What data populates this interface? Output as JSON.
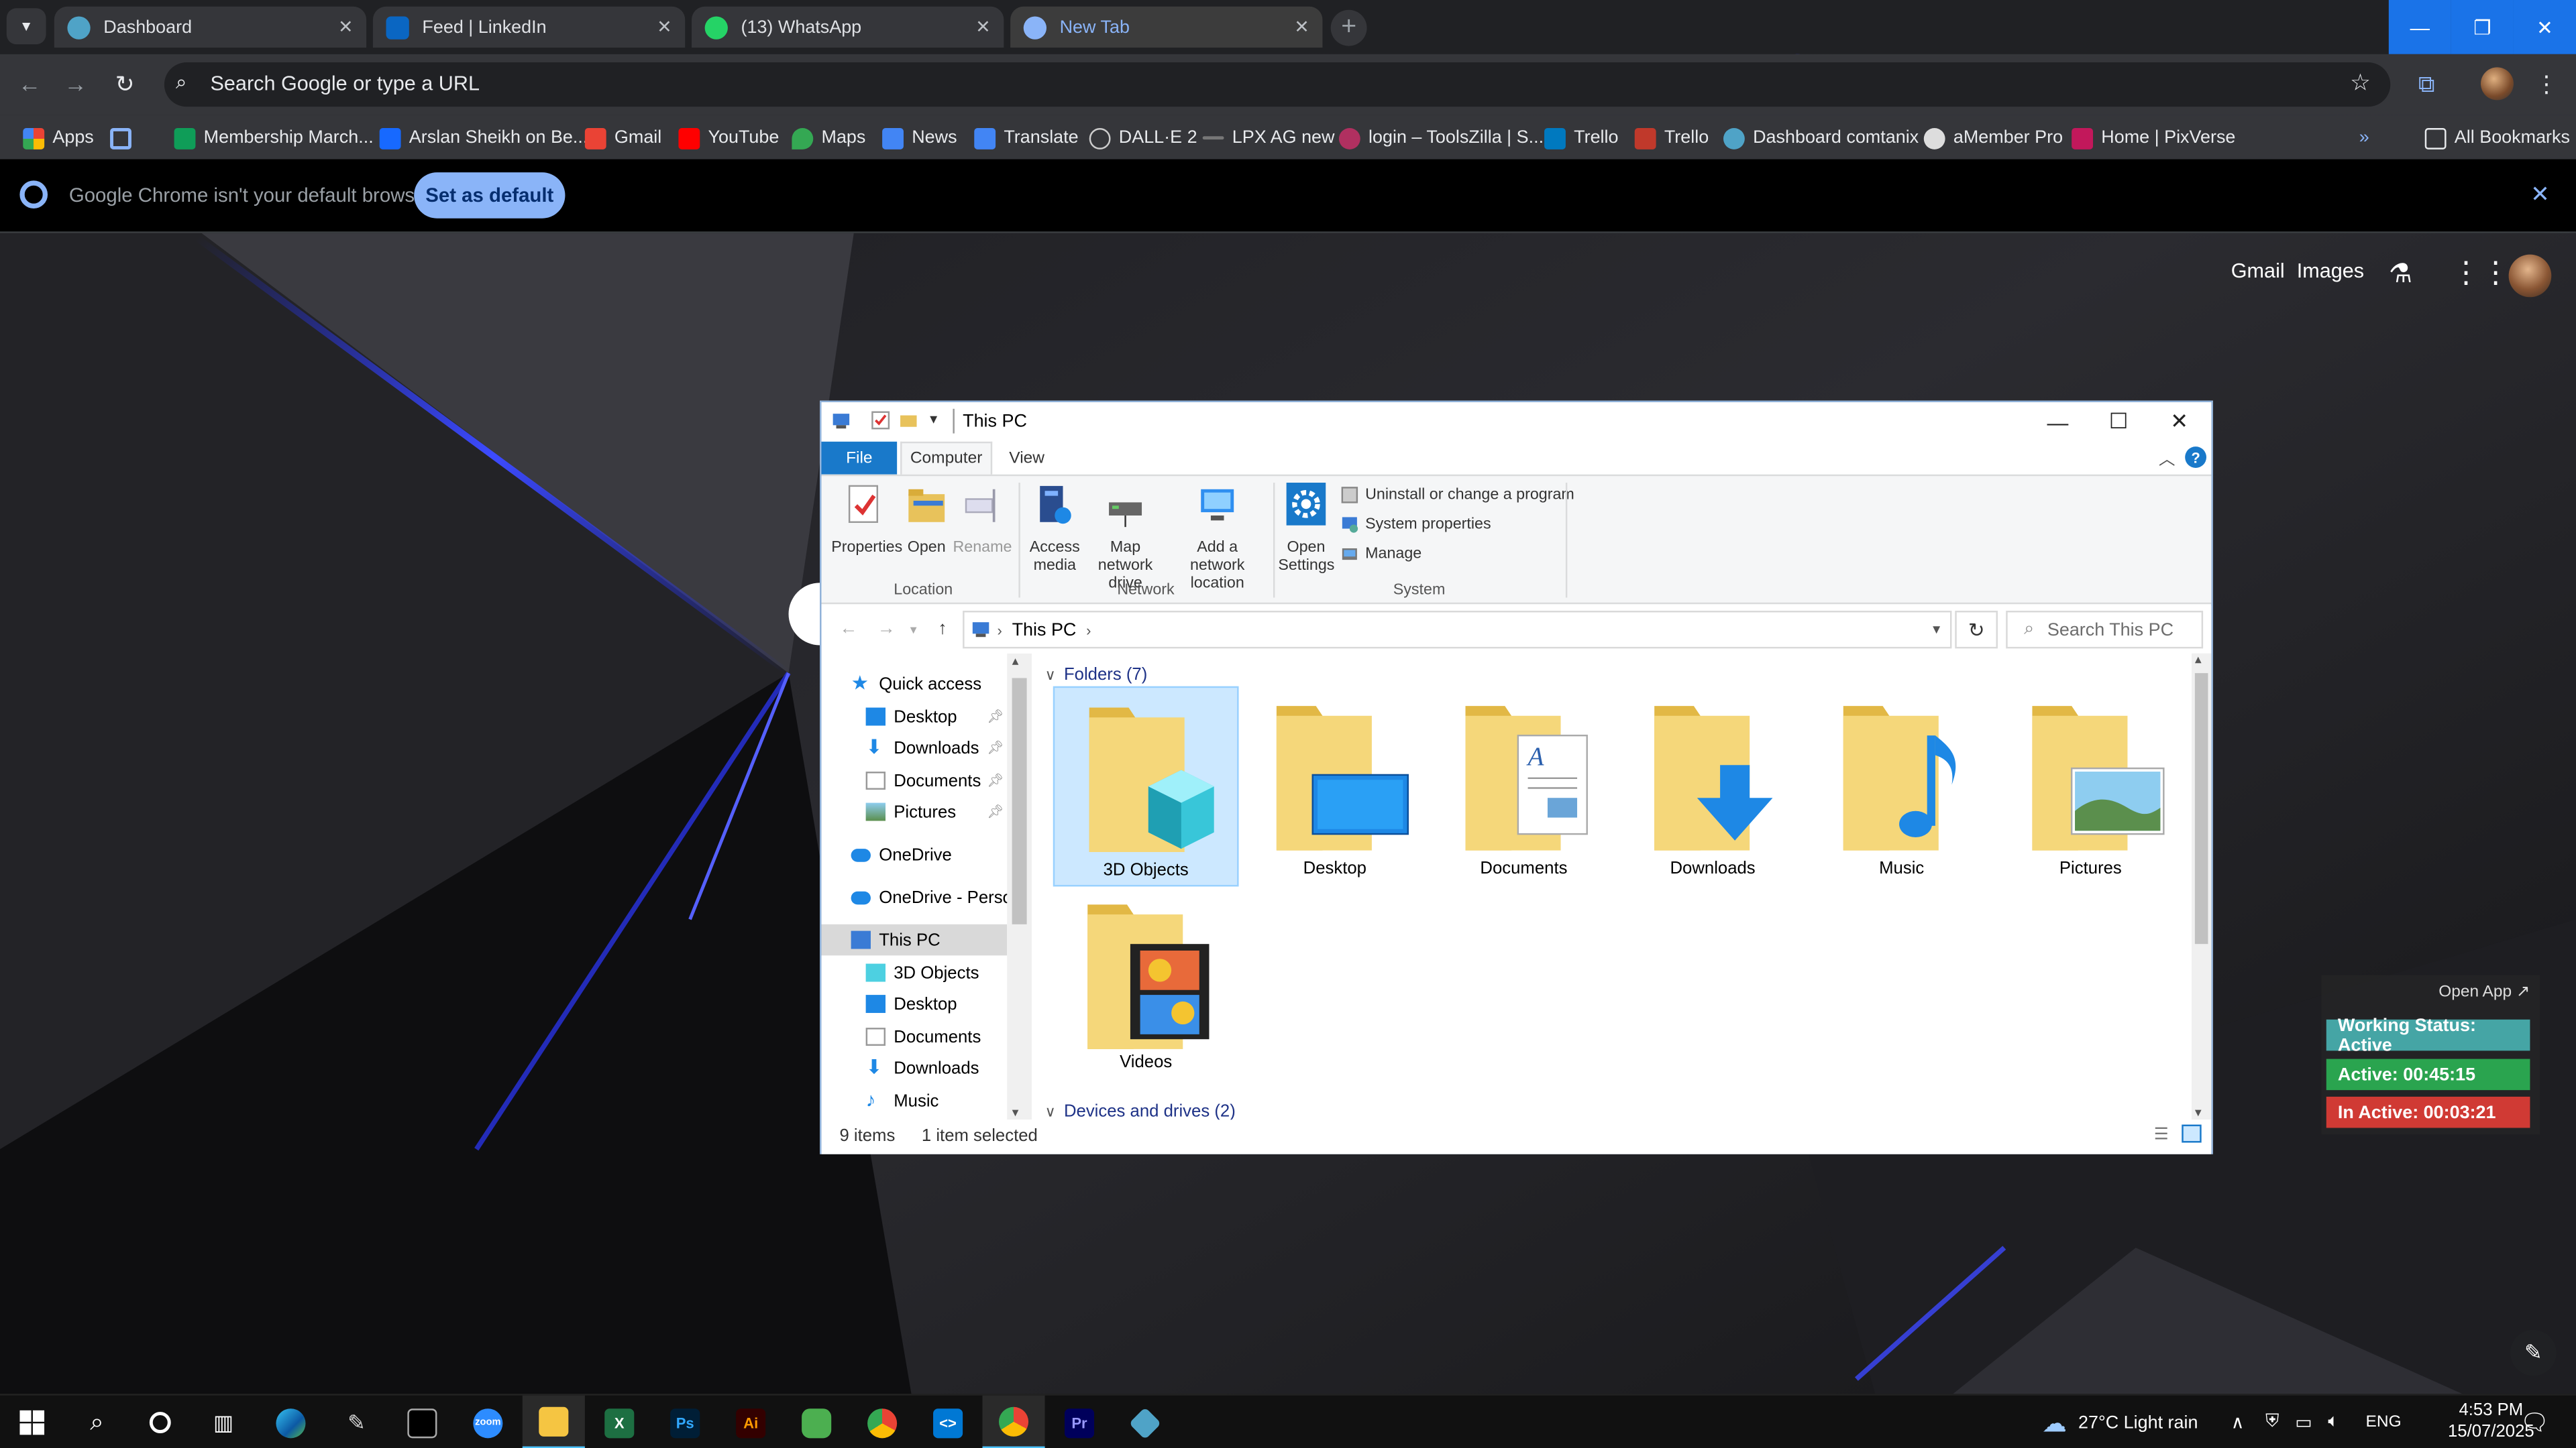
{
  "chrome": {
    "tabs": [
      {
        "title": "Dashboard",
        "favicon": "dashboard-favicon",
        "color": "#4fa3c7"
      },
      {
        "title": "Feed | LinkedIn",
        "favicon": "linkedin-favicon",
        "color": "#0a66c2"
      },
      {
        "title": "(13) WhatsApp",
        "favicon": "whatsapp-favicon",
        "color": "#25d366"
      },
      {
        "title": "New Tab",
        "favicon": "chrome-favicon",
        "color": "#8ab4f8"
      }
    ],
    "omnibox_placeholder": "Search Google or type a URL",
    "bookmarks": [
      {
        "label": "Apps",
        "color": "#8ab4f8"
      },
      {
        "label": "",
        "color": "#8ab4f8"
      },
      {
        "label": "Membership March...",
        "color": "#0f9d58"
      },
      {
        "label": "Arslan Sheikh on Be...",
        "color": "#1769ff"
      },
      {
        "label": "Gmail",
        "color": "#ea4335"
      },
      {
        "label": "YouTube",
        "color": "#ff0000"
      },
      {
        "label": "Maps",
        "color": "#34a853"
      },
      {
        "label": "News",
        "color": "#4285f4"
      },
      {
        "label": "Translate",
        "color": "#4285f4"
      },
      {
        "label": "DALL·E 2",
        "color": "#cccccc"
      },
      {
        "label": "LPX AG new",
        "color": "#777777"
      },
      {
        "label": "login – ToolsZilla | S...",
        "color": "#b03060"
      },
      {
        "label": "Trello",
        "color": "#0079bf"
      },
      {
        "label": "Trello",
        "color": "#c0392b"
      },
      {
        "label": "Dashboard comtanix",
        "color": "#4fa3c7"
      },
      {
        "label": "aMember Pro",
        "color": "#dddddd"
      },
      {
        "label": "Home | PixVerse",
        "color": "#c2185b"
      }
    ],
    "all_bookmarks": "All Bookmarks",
    "infobar": {
      "message": "Google Chrome isn't your default browser",
      "button": "Set as default"
    },
    "ntp": {
      "gmail": "Gmail",
      "images": "Images"
    }
  },
  "explorer": {
    "title": "This PC",
    "ribbon_tabs": {
      "file": "File",
      "computer": "Computer",
      "view": "View"
    },
    "ribbon": {
      "properties": "Properties",
      "open": "Open",
      "rename": "Rename",
      "access_media": "Access media",
      "map_network_drive": "Map network drive",
      "add_network_location": "Add a network location",
      "open_settings": "Open Settings",
      "uninstall": "Uninstall or change a program",
      "system_properties": "System properties",
      "manage": "Manage",
      "group_location": "Location",
      "group_network": "Network",
      "group_system": "System"
    },
    "address": "This PC",
    "search_placeholder": "Search This PC",
    "nav": {
      "quick_access": "Quick access",
      "qa_items": [
        "Desktop",
        "Downloads",
        "Documents",
        "Pictures"
      ],
      "onedrive": "OneDrive",
      "onedrive_personal": "OneDrive - Personal",
      "this_pc": "This PC",
      "pc_items": [
        "3D Objects",
        "Desktop",
        "Documents",
        "Downloads",
        "Music"
      ]
    },
    "folders_header": "Folders (7)",
    "folders": [
      "3D Objects",
      "Desktop",
      "Documents",
      "Downloads",
      "Music",
      "Pictures",
      "Videos"
    ],
    "devices_header": "Devices and drives (2)",
    "status_items": "9 items",
    "status_selected": "1 item selected"
  },
  "tracker": {
    "open_app": "Open App ↗",
    "working_status": "Working Status: Active",
    "active": "Active: 00:45:15",
    "inactive": "In Active: 00:03:21",
    "colors": {
      "status": "#45a5a5",
      "active": "#2aa44f",
      "inactive": "#d03a34"
    }
  },
  "taskbar": {
    "weather": "27°C  Light rain",
    "language": "ENG",
    "time": "4:53 PM",
    "date": "15/07/2025",
    "apps": [
      {
        "name": "start-icon"
      },
      {
        "name": "search-icon"
      },
      {
        "name": "cortana-icon"
      },
      {
        "name": "task-view-icon"
      },
      {
        "name": "edge-icon"
      },
      {
        "name": "pen-icon"
      },
      {
        "name": "terminal-icon"
      },
      {
        "name": "zoom-icon"
      },
      {
        "name": "file-explorer-icon"
      },
      {
        "name": "excel-icon"
      },
      {
        "name": "photoshop-icon"
      },
      {
        "name": "illustrator-icon"
      },
      {
        "name": "tool-icon"
      },
      {
        "name": "chrome-icon"
      },
      {
        "name": "vscode-icon"
      },
      {
        "name": "chrome-profile-icon"
      },
      {
        "name": "premiere-icon"
      },
      {
        "name": "app-icon"
      }
    ]
  }
}
